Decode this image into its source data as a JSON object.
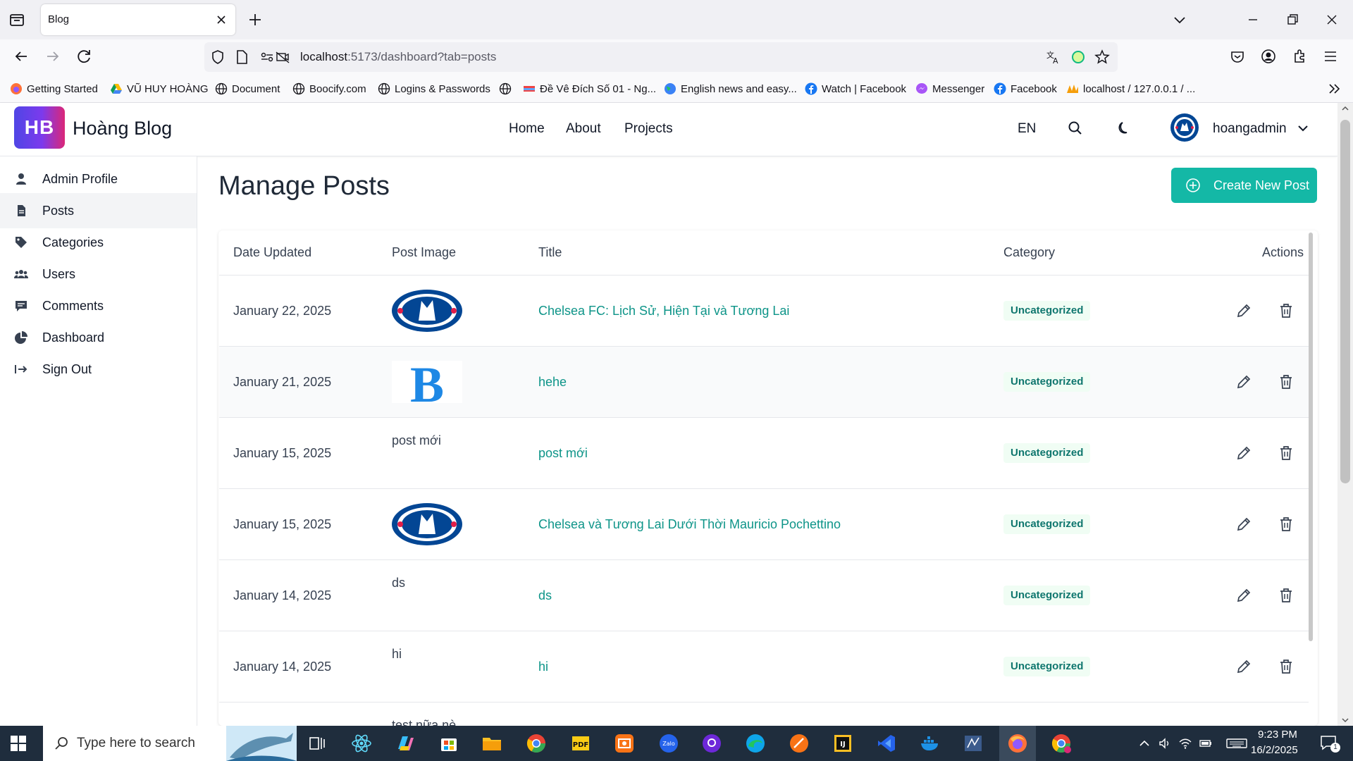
{
  "browser": {
    "tab_title": "Blog",
    "url_host": "localhost",
    "url_rest": ":5173/dashboard?tab=posts",
    "bookmarks": [
      {
        "label": "Getting Started",
        "icon": "firefox-icon"
      },
      {
        "label": "VŨ HUY HOÀNG",
        "icon": "google-drive-icon"
      },
      {
        "label": "Document",
        "icon": "globe-icon"
      },
      {
        "label": "Boocify.com",
        "icon": "globe-icon"
      },
      {
        "label": "Logins & Passwords",
        "icon": "globe-icon"
      },
      {
        "label": "",
        "icon": "globe-icon"
      },
      {
        "label": "Đề Vê Đích Số 01 - Ng...",
        "icon": "flag-icon"
      },
      {
        "label": "English news and easy...",
        "icon": "earth-icon"
      },
      {
        "label": "Watch | Facebook",
        "icon": "facebook-icon"
      },
      {
        "label": "Messenger",
        "icon": "messenger-icon"
      },
      {
        "label": "Facebook",
        "icon": "facebook-icon"
      },
      {
        "label": "localhost / 127.0.0.1 / ...",
        "icon": "phpmyadmin-icon"
      }
    ]
  },
  "header": {
    "logo_badge": "HB",
    "logo_text": "Hoàng Blog",
    "nav": [
      "Home",
      "About",
      "Projects"
    ],
    "language": "EN",
    "username": "hoangadmin"
  },
  "sidebar": {
    "items": [
      {
        "label": "Admin Profile",
        "icon": "user-icon"
      },
      {
        "label": "Posts",
        "icon": "document-icon",
        "active": true
      },
      {
        "label": "Categories",
        "icon": "tag-icon"
      },
      {
        "label": "Users",
        "icon": "users-icon"
      },
      {
        "label": "Comments",
        "icon": "comment-icon"
      },
      {
        "label": "Dashboard",
        "icon": "pie-chart-icon"
      },
      {
        "label": "Sign Out",
        "icon": "sign-out-icon"
      }
    ]
  },
  "main": {
    "title": "Manage Posts",
    "create_button": "Create New Post",
    "columns": [
      "Date Updated",
      "Post Image",
      "Title",
      "Category",
      "Actions"
    ],
    "rows": [
      {
        "date": "January 22, 2025",
        "image": "chelsea-crest",
        "image_alt": "",
        "title": "Chelsea FC: Lịch Sử, Hiện Tại và Tương Lai",
        "category": "Uncategorized"
      },
      {
        "date": "January 21, 2025",
        "image": "letter-b",
        "image_alt": "",
        "title": "hehe",
        "category": "Uncategorized"
      },
      {
        "date": "January 15, 2025",
        "image": "",
        "image_alt": "post mới",
        "title": "post mới",
        "category": "Uncategorized"
      },
      {
        "date": "January 15, 2025",
        "image": "chelsea-crest",
        "image_alt": "",
        "title": "Chelsea và Tương Lai Dưới Thời Mauricio Pochettino",
        "category": "Uncategorized"
      },
      {
        "date": "January 14, 2025",
        "image": "",
        "image_alt": "ds",
        "title": "ds",
        "category": "Uncategorized"
      },
      {
        "date": "January 14, 2025",
        "image": "",
        "image_alt": "hi",
        "title": "hi",
        "category": "Uncategorized"
      }
    ],
    "partial_row_text": "test nữa nè"
  },
  "taskbar": {
    "search_placeholder": "Type here to search",
    "time": "9:23 PM",
    "date": "16/2/2025",
    "notification_count": "1"
  },
  "colors": {
    "accent": "#14b8a6",
    "link": "#0d9488",
    "chelsea_blue": "#034694"
  }
}
